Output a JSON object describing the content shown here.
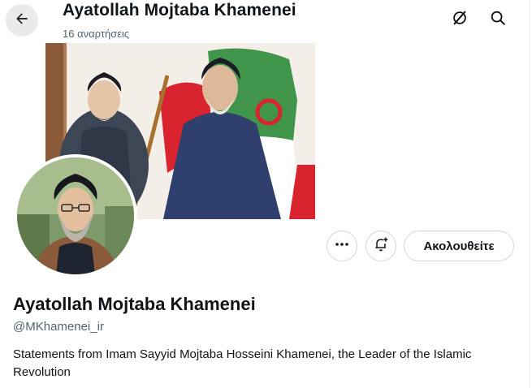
{
  "header": {
    "title": "Ayatollah Mojtaba Khamenei",
    "post_count": "16 αναρτήσεις",
    "back_icon": "arrow-left-icon",
    "grok_icon": "grok-icon",
    "search_icon": "search-icon"
  },
  "actions": {
    "more_icon": "more-icon",
    "notify_icon": "bell-plus-icon",
    "follow_label": "Ακολουθείτε"
  },
  "profile": {
    "name": "Ayatollah Mojtaba Khamenei",
    "handle": "@MKhamenei_ir",
    "bio": "Statements from Imam Sayyid Mojtaba Hosseini Khamenei, the Leader of the Islamic Revolution"
  },
  "colors": {
    "text_primary": "#0f1419",
    "text_secondary": "#536471",
    "border": "#cfd9de"
  }
}
